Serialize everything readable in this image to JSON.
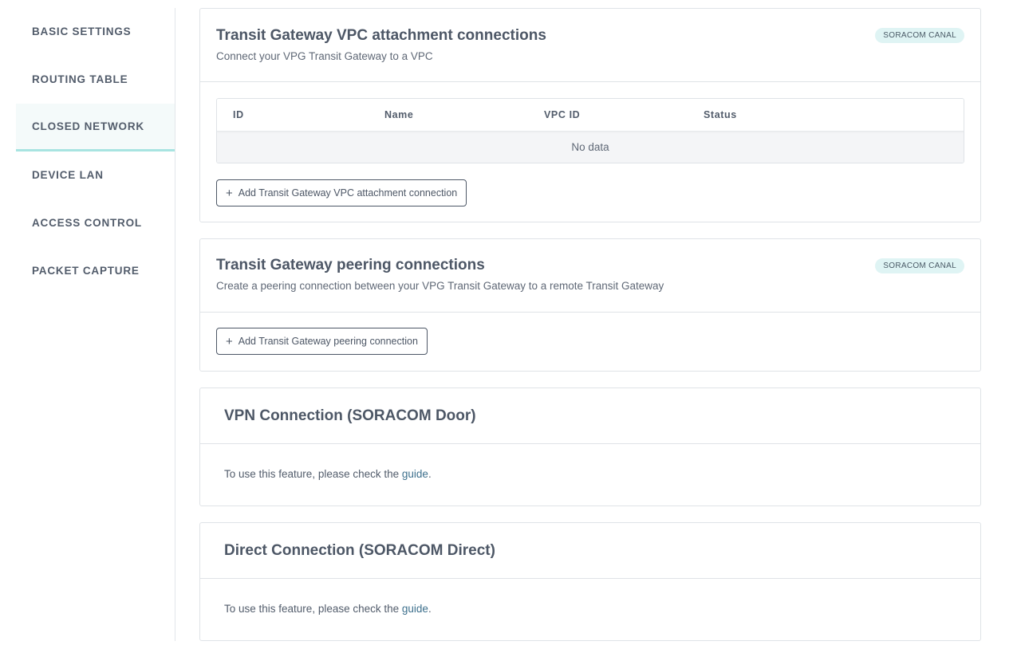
{
  "sidebar": {
    "items": [
      {
        "label": "BASIC SETTINGS"
      },
      {
        "label": "ROUTING TABLE"
      },
      {
        "label": "CLOSED NETWORK"
      },
      {
        "label": "DEVICE LAN"
      },
      {
        "label": "ACCESS CONTROL"
      },
      {
        "label": "PACKET CAPTURE"
      }
    ],
    "active": "CLOSED NETWORK"
  },
  "vpc_attachment": {
    "title": "Transit Gateway VPC attachment connections",
    "subtitle": "Connect your VPG Transit Gateway to a VPC",
    "badge": "SORACOM CANAL",
    "table": {
      "columns": [
        "ID",
        "Name",
        "VPC ID",
        "Status"
      ],
      "empty_text": "No data"
    },
    "add_button": "Add Transit Gateway VPC attachment connection"
  },
  "peering": {
    "title": "Transit Gateway peering connections",
    "subtitle": "Create a peering connection between your VPG Transit Gateway to a remote Transit Gateway",
    "badge": "SORACOM CANAL",
    "add_button": "Add Transit Gateway peering connection"
  },
  "vpn": {
    "title": "VPN Connection (SORACOM Door)",
    "text_prefix": "To use this feature, please check the ",
    "link": "guide",
    "text_suffix": "."
  },
  "direct": {
    "title": "Direct Connection (SORACOM Direct)",
    "text_prefix": "To use this feature, please check the ",
    "link": "guide",
    "text_suffix": "."
  },
  "colors": {
    "accent_underline": "#a8e4e1",
    "badge_bg": "#dff4f4",
    "link": "#3c6f8c"
  }
}
